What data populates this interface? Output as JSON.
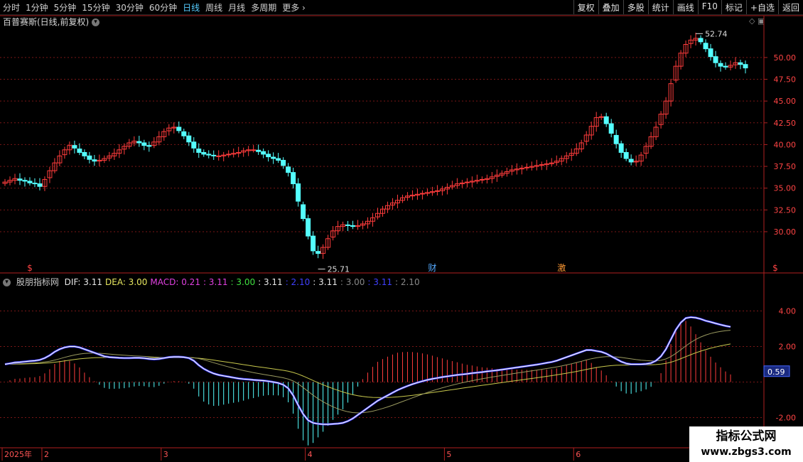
{
  "toolbar": {
    "periods": [
      "分时",
      "1分钟",
      "5分钟",
      "15分钟",
      "30分钟",
      "60分钟",
      "日线",
      "周线",
      "月线",
      "多周期",
      "更多"
    ],
    "active_period": "日线",
    "buttons": [
      "复权",
      "叠加",
      "多股",
      "统计",
      "画线",
      "F10",
      "标记",
      "+自选",
      "返回"
    ]
  },
  "stock": {
    "title": "百普赛斯(日线,前复权)"
  },
  "indicator": {
    "name": "股朋指标网",
    "labels": [
      {
        "text": "DIF: 3.11",
        "color": "#e8e8e8"
      },
      {
        "text": "DEA: 3.00",
        "color": "#e8e860"
      },
      {
        "text": "MACD: 0.21",
        "color": "#e040e0"
      },
      {
        "text": ": 3.11",
        "color": "#e040e0"
      },
      {
        "text": ": 3.00",
        "color": "#40e040"
      },
      {
        "text": ": 3.11",
        "color": "#e8e8e8"
      },
      {
        "text": ": 2.10",
        "color": "#4040ff"
      },
      {
        "text": ": 3.11",
        "color": "#e8e8e8"
      },
      {
        "text": ": 3.00",
        "color": "#888888"
      },
      {
        "text": ": 3.11",
        "color": "#4040ff"
      },
      {
        "text": ": 2.10",
        "color": "#888888"
      }
    ]
  },
  "watermark": {
    "line1": "指标公式网",
    "line2": "www.zbgs3.com"
  },
  "chart_data": {
    "type": "candlestick",
    "colors": {
      "up": "#ff3c3c",
      "down": "#54ffff",
      "axis": "#b02020",
      "dif": "#ffffff",
      "dea": "#c8c84c"
    },
    "price_ticks": [
      "50.00",
      "47.50",
      "45.00",
      "42.50",
      "40.00",
      "37.50",
      "35.00",
      "32.50",
      "30.00"
    ],
    "price_tick_values": [
      50,
      47.5,
      45,
      42.5,
      40,
      37.5,
      35,
      32.5,
      30
    ],
    "ylim": [
      26.0,
      53.5
    ],
    "annotations": [
      {
        "text": "52.74",
        "value": 52.74
      },
      {
        "text": "25.71",
        "value": 25.71
      }
    ],
    "event_markers": [
      {
        "text": "$",
        "index": 5
      },
      {
        "text": "财",
        "index": 86
      },
      {
        "text": "激",
        "index": 112
      },
      {
        "text": "$",
        "index": 155
      }
    ],
    "macd_ticks": [
      "4.00",
      "2.00",
      "-2.00"
    ],
    "macd_tick_values": [
      4,
      2,
      -2
    ],
    "macd_ylim": [
      -3.5,
      5.5
    ],
    "macd_current": "0.59",
    "date_labels": [
      {
        "text": "2025年",
        "index": 0
      },
      {
        "text": "2",
        "index": 8
      },
      {
        "text": "3",
        "index": 32
      },
      {
        "text": "4",
        "index": 61
      },
      {
        "text": "5",
        "index": 89
      },
      {
        "text": "6",
        "index": 115
      }
    ],
    "closes": [
      35.7,
      35.9,
      36.1,
      35.9,
      35.8,
      35.6,
      35.5,
      35.2,
      36.0,
      37.0,
      37.9,
      38.7,
      39.4,
      39.9,
      39.6,
      39.1,
      38.7,
      38.3,
      38.1,
      38.2,
      38.4,
      38.7,
      39.0,
      39.4,
      39.8,
      40.2,
      40.4,
      40.2,
      39.9,
      39.8,
      40.3,
      40.9,
      41.5,
      41.9,
      42.0,
      41.6,
      41.0,
      40.3,
      39.6,
      39.1,
      38.9,
      38.8,
      38.7,
      38.7,
      38.8,
      38.9,
      39.0,
      39.1,
      39.3,
      39.4,
      39.4,
      39.2,
      38.9,
      38.6,
      38.4,
      38.2,
      37.6,
      36.8,
      35.5,
      33.5,
      31.5,
      29.5,
      27.8,
      27.5,
      28.2,
      29.2,
      30.1,
      30.6,
      30.8,
      30.7,
      30.6,
      30.7,
      30.9,
      31.2,
      31.6,
      32.1,
      32.6,
      33.0,
      33.3,
      33.6,
      33.9,
      34.1,
      34.2,
      34.3,
      34.4,
      34.5,
      34.6,
      34.7,
      34.9,
      35.1,
      35.3,
      35.5,
      35.6,
      35.7,
      35.8,
      35.9,
      36.0,
      36.1,
      36.3,
      36.5,
      36.7,
      36.9,
      37.1,
      37.2,
      37.3,
      37.4,
      37.5,
      37.6,
      37.7,
      37.8,
      37.9,
      38.1,
      38.4,
      38.7,
      39.0,
      39.5,
      40.2,
      41.1,
      42.1,
      43.1,
      43.2,
      42.4,
      41.3,
      40.1,
      39.1,
      38.4,
      38.0,
      38.1,
      38.8,
      39.8,
      40.9,
      42.0,
      43.5,
      45.0,
      47.0,
      49.0,
      50.5,
      51.5,
      52.0,
      52.2,
      51.8,
      51.0,
      50.1,
      49.4,
      49.0,
      48.9,
      49.1,
      49.4,
      49.2,
      48.8
    ],
    "dif": [
      1.0,
      1.05,
      1.1,
      1.12,
      1.15,
      1.18,
      1.2,
      1.25,
      1.35,
      1.5,
      1.7,
      1.85,
      1.95,
      2.0,
      2.0,
      1.95,
      1.85,
      1.75,
      1.65,
      1.55,
      1.45,
      1.4,
      1.38,
      1.36,
      1.35,
      1.35,
      1.36,
      1.36,
      1.34,
      1.3,
      1.28,
      1.3,
      1.35,
      1.4,
      1.42,
      1.42,
      1.4,
      1.35,
      1.2,
      0.95,
      0.75,
      0.6,
      0.48,
      0.4,
      0.35,
      0.3,
      0.25,
      0.2,
      0.17,
      0.15,
      0.12,
      0.1,
      0.08,
      0.05,
      0.0,
      -0.05,
      -0.15,
      -0.35,
      -0.75,
      -1.3,
      -1.8,
      -2.15,
      -2.3,
      -2.35,
      -2.38,
      -2.38,
      -2.36,
      -2.34,
      -2.3,
      -2.2,
      -2.05,
      -1.85,
      -1.65,
      -1.45,
      -1.25,
      -1.05,
      -0.9,
      -0.75,
      -0.6,
      -0.45,
      -0.33,
      -0.22,
      -0.12,
      -0.03,
      0.05,
      0.12,
      0.18,
      0.23,
      0.28,
      0.32,
      0.36,
      0.4,
      0.43,
      0.46,
      0.5,
      0.53,
      0.56,
      0.6,
      0.63,
      0.66,
      0.7,
      0.74,
      0.78,
      0.82,
      0.86,
      0.9,
      0.94,
      0.98,
      1.03,
      1.08,
      1.13,
      1.2,
      1.3,
      1.4,
      1.5,
      1.6,
      1.7,
      1.8,
      1.8,
      1.75,
      1.7,
      1.6,
      1.45,
      1.3,
      1.15,
      1.05,
      1.0,
      1.0,
      1.0,
      1.02,
      1.07,
      1.2,
      1.45,
      1.85,
      2.4,
      2.95,
      3.35,
      3.6,
      3.65,
      3.62,
      3.55,
      3.45,
      3.38,
      3.3,
      3.23,
      3.16,
      3.11
    ]
  }
}
